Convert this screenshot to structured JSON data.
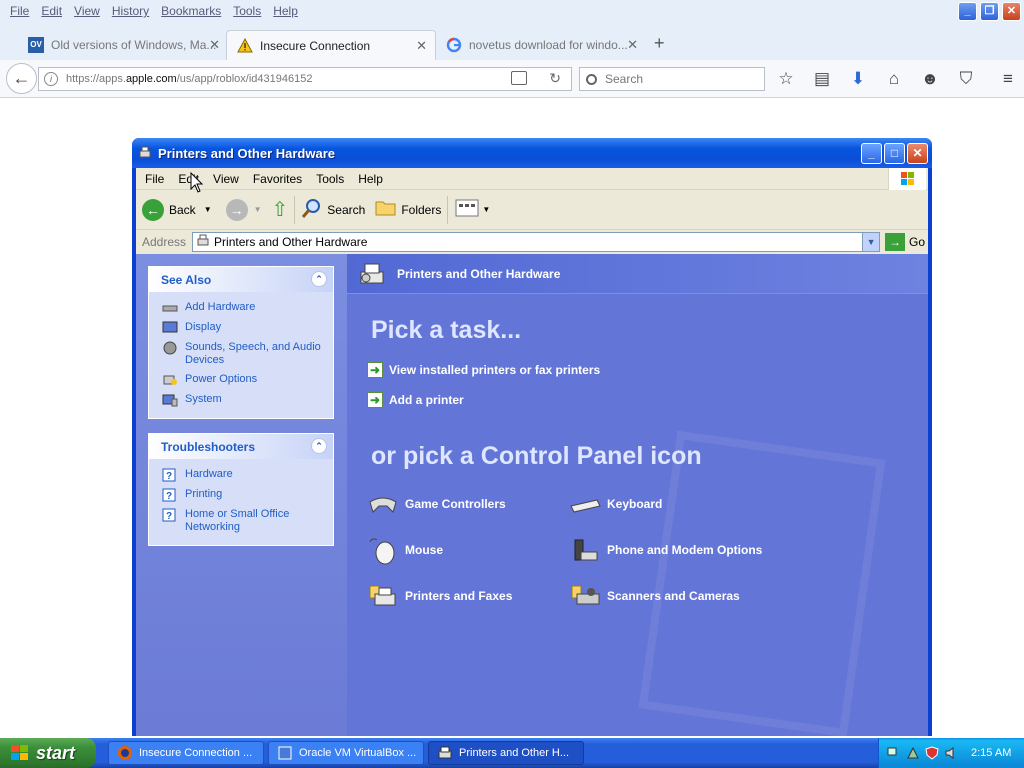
{
  "firefox": {
    "menu": [
      "File",
      "Edit",
      "View",
      "History",
      "Bookmarks",
      "Tools",
      "Help"
    ],
    "tabs": [
      {
        "title": "Old versions of Windows, Ma...",
        "icon": "ov-favicon"
      },
      {
        "title": "Insecure Connection",
        "icon": "warning-icon"
      },
      {
        "title": "novetus download for windo...",
        "icon": "google-icon"
      }
    ],
    "url_prefix": "https://apps.",
    "url_domain": "apple.com",
    "url_suffix": "/us/app/roblox/id431946152",
    "search_placeholder": "Search"
  },
  "window": {
    "title": "Printers and Other Hardware",
    "menu": [
      "File",
      "Edit",
      "View",
      "Favorites",
      "Tools",
      "Help"
    ],
    "toolbar": {
      "back": "Back",
      "search": "Search",
      "folders": "Folders"
    },
    "address_label": "Address",
    "address_value": "Printers and Other Hardware",
    "go_label": "Go"
  },
  "see_also": {
    "title": "See Also",
    "items": [
      {
        "label": "Add Hardware",
        "icon": "add-hardware-icon"
      },
      {
        "label": "Display",
        "icon": "display-icon"
      },
      {
        "label": "Sounds, Speech, and Audio Devices",
        "icon": "sounds-icon"
      },
      {
        "label": "Power Options",
        "icon": "power-icon"
      },
      {
        "label": "System",
        "icon": "system-icon"
      }
    ]
  },
  "troubleshooters": {
    "title": "Troubleshooters",
    "items": [
      {
        "label": "Hardware",
        "icon": "help-icon"
      },
      {
        "label": "Printing",
        "icon": "help-icon"
      },
      {
        "label": "Home or Small Office Networking",
        "icon": "help-icon"
      }
    ]
  },
  "main": {
    "header": "Printers and Other Hardware",
    "pick_task": "Pick a task...",
    "tasks": [
      "View installed printers or fax printers",
      "Add a printer"
    ],
    "pick_icon": "or pick a Control Panel icon",
    "icons": [
      {
        "label": "Game Controllers",
        "icon": "game-controller-icon"
      },
      {
        "label": "Keyboard",
        "icon": "keyboard-icon"
      },
      {
        "label": "Mouse",
        "icon": "mouse-icon"
      },
      {
        "label": "Phone and Modem Options",
        "icon": "phone-icon"
      },
      {
        "label": "Printers and Faxes",
        "icon": "printer-icon"
      },
      {
        "label": "Scanners and Cameras",
        "icon": "scanner-icon"
      }
    ]
  },
  "taskbar": {
    "start": "start",
    "buttons": [
      "Insecure Connection ...",
      "Oracle VM VirtualBox ...",
      "Printers and Other H..."
    ],
    "clock": "2:15 AM"
  }
}
